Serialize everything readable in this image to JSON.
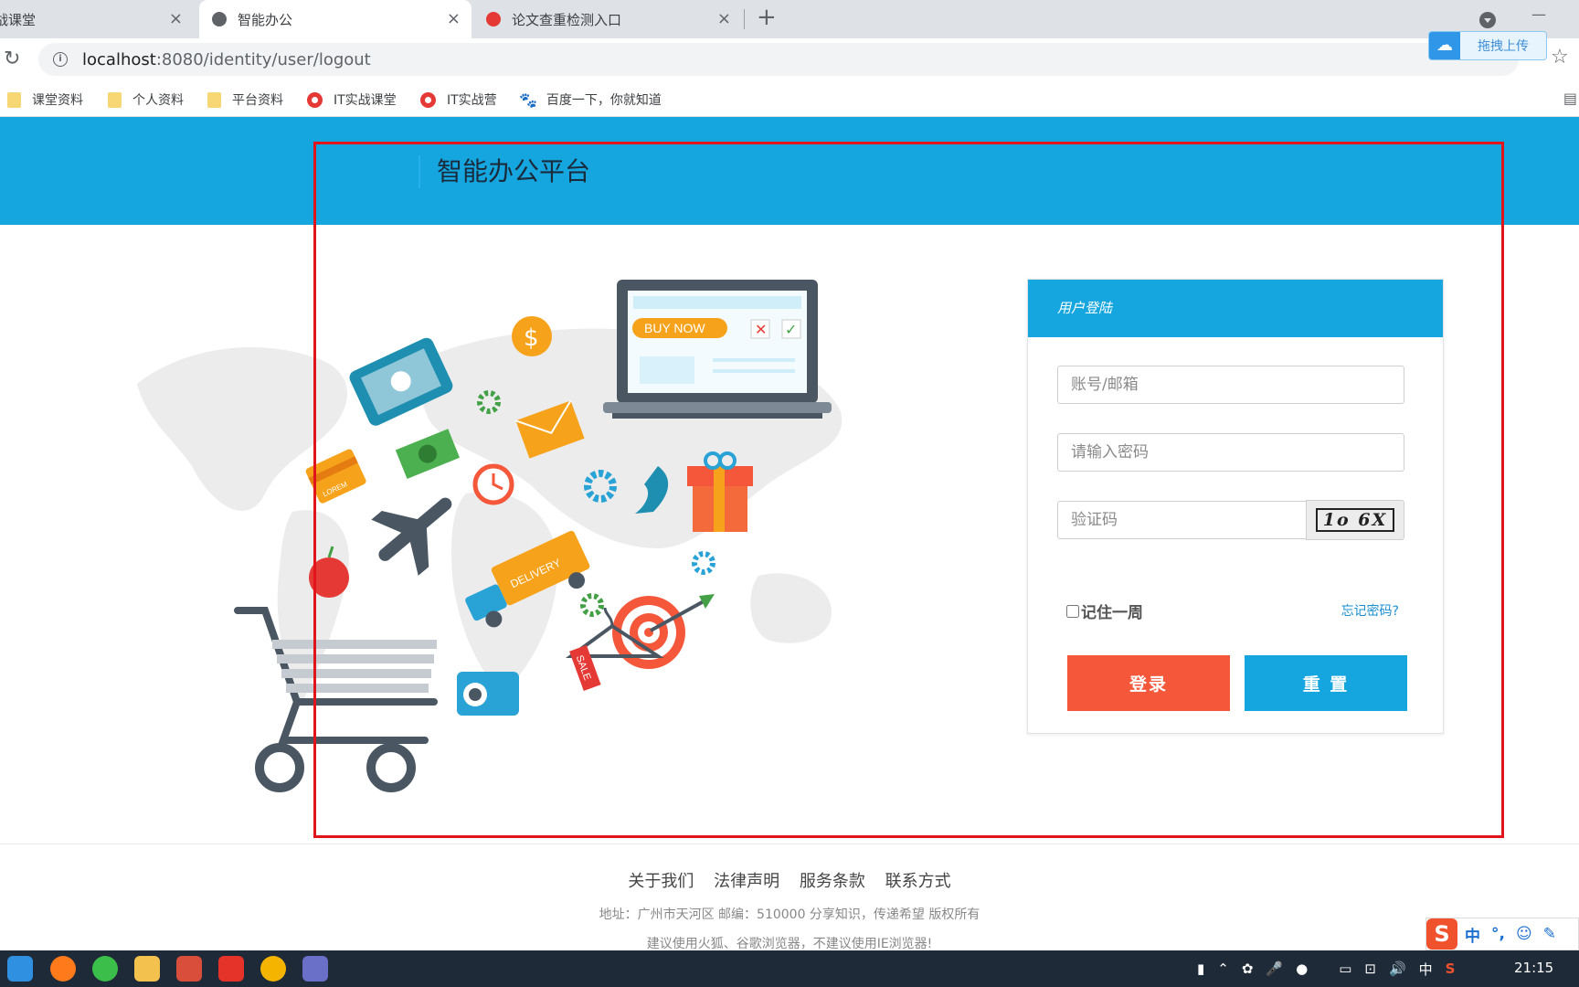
{
  "tabs": [
    {
      "title": "战课堂",
      "active": false
    },
    {
      "title": "智能办公",
      "active": true
    },
    {
      "title": "论文查重检测入口",
      "active": false
    }
  ],
  "toolbar": {
    "url_host": "localhost",
    "url_rest": ":8080/identity/user/logout",
    "upload_label": "拖拽上传"
  },
  "bookmarks": [
    {
      "label": "课堂资料",
      "icon": "folder-icon"
    },
    {
      "label": "个人资料",
      "icon": "folder-icon"
    },
    {
      "label": "平台资料",
      "icon": "folder-icon"
    },
    {
      "label": "IT实战课堂",
      "icon": "site-logo-icon"
    },
    {
      "label": "IT实战营",
      "icon": "site-logo-icon"
    },
    {
      "label": "百度一下，你就知道",
      "icon": "baidu-paw-icon"
    }
  ],
  "header": {
    "title": "智能办公平台"
  },
  "illustration": {
    "buy_now": "BUY NOW",
    "delivery": "DELIVERY",
    "sale": "SALE",
    "lorem": "LOREM"
  },
  "login": {
    "heading": "用户登陆",
    "account_placeholder": "账号/邮箱",
    "password_placeholder": "请输入密码",
    "captcha_placeholder": "验证码",
    "captcha_text": "1o 6X",
    "remember_label": "记住一周",
    "forgot_label": "忘记密码?",
    "login_button": "登录",
    "reset_button": "重 置"
  },
  "footer": {
    "links": [
      "关于我们",
      "法律声明",
      "服务条款",
      "联系方式"
    ],
    "address": "地址：广州市天河区  邮编：510000   分享知识，传递希望 版权所有",
    "note": "建议使用火狐、谷歌浏览器，不建议使用IE浏览器!"
  },
  "ime": {
    "lang": "中"
  },
  "tray": {
    "lang": "中"
  },
  "taskbar": {
    "clock": "21:15"
  }
}
